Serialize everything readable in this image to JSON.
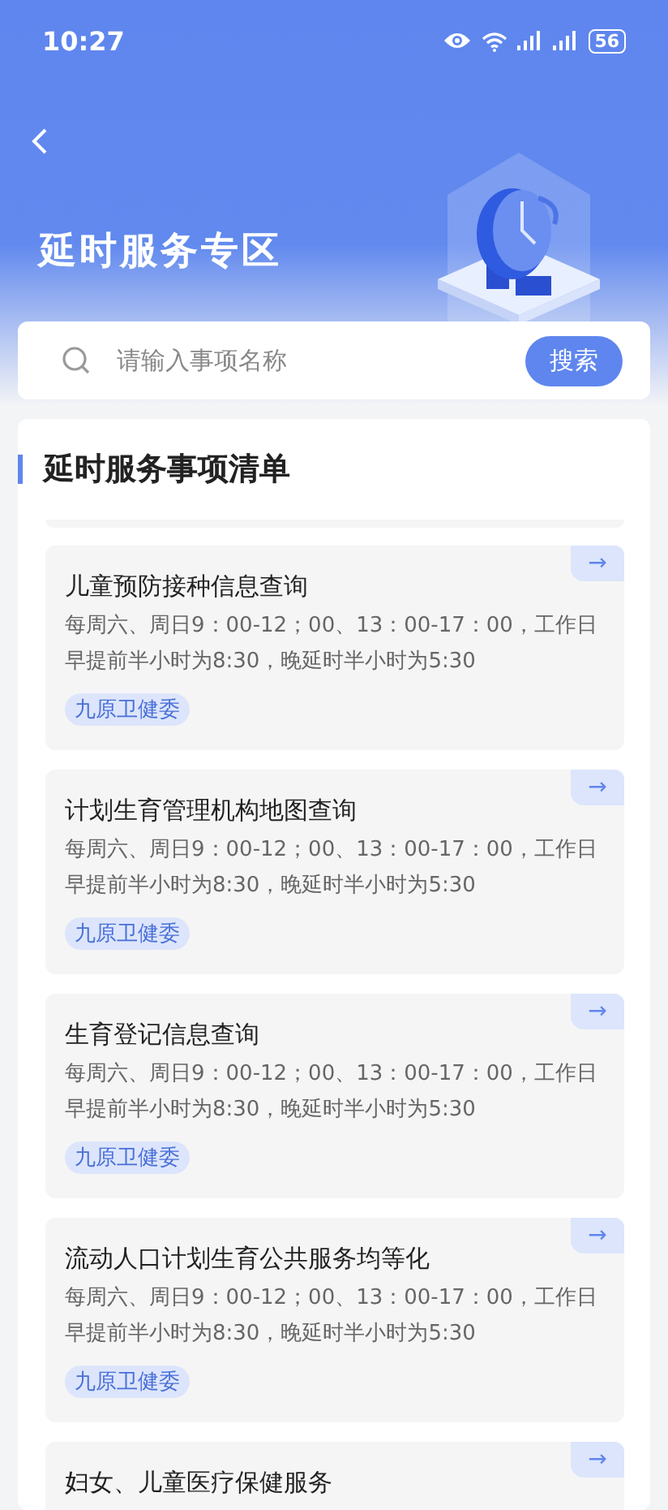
{
  "status_bar": {
    "time": "10:27",
    "battery": "56"
  },
  "header": {
    "title": "延时服务专区"
  },
  "search": {
    "placeholder": "请输入事项名称",
    "button": "搜索"
  },
  "list": {
    "heading": "延时服务事项清单",
    "items": [
      {
        "title": "儿童预防接种信息查询",
        "description": "每周六、周日9：00-12；00、13：00-17：00，工作日早提前半小时为8:30，晚延时半小时为5:30",
        "tag": "九原卫健委",
        "arrow": "→"
      },
      {
        "title": "计划生育管理机构地图查询",
        "description": "每周六、周日9：00-12；00、13：00-17：00，工作日早提前半小时为8:30，晚延时半小时为5:30",
        "tag": "九原卫健委",
        "arrow": "→"
      },
      {
        "title": "生育登记信息查询",
        "description": "每周六、周日9：00-12；00、13：00-17：00，工作日早提前半小时为8:30，晚延时半小时为5:30",
        "tag": "九原卫健委",
        "arrow": "→"
      },
      {
        "title": "流动人口计划生育公共服务均等化",
        "description": "每周六、周日9：00-12；00、13：00-17：00，工作日早提前半小时为8:30，晚延时半小时为5:30",
        "tag": "九原卫健委",
        "arrow": "→"
      },
      {
        "title": "妇女、儿童医疗保健服务",
        "arrow": "→"
      }
    ]
  }
}
